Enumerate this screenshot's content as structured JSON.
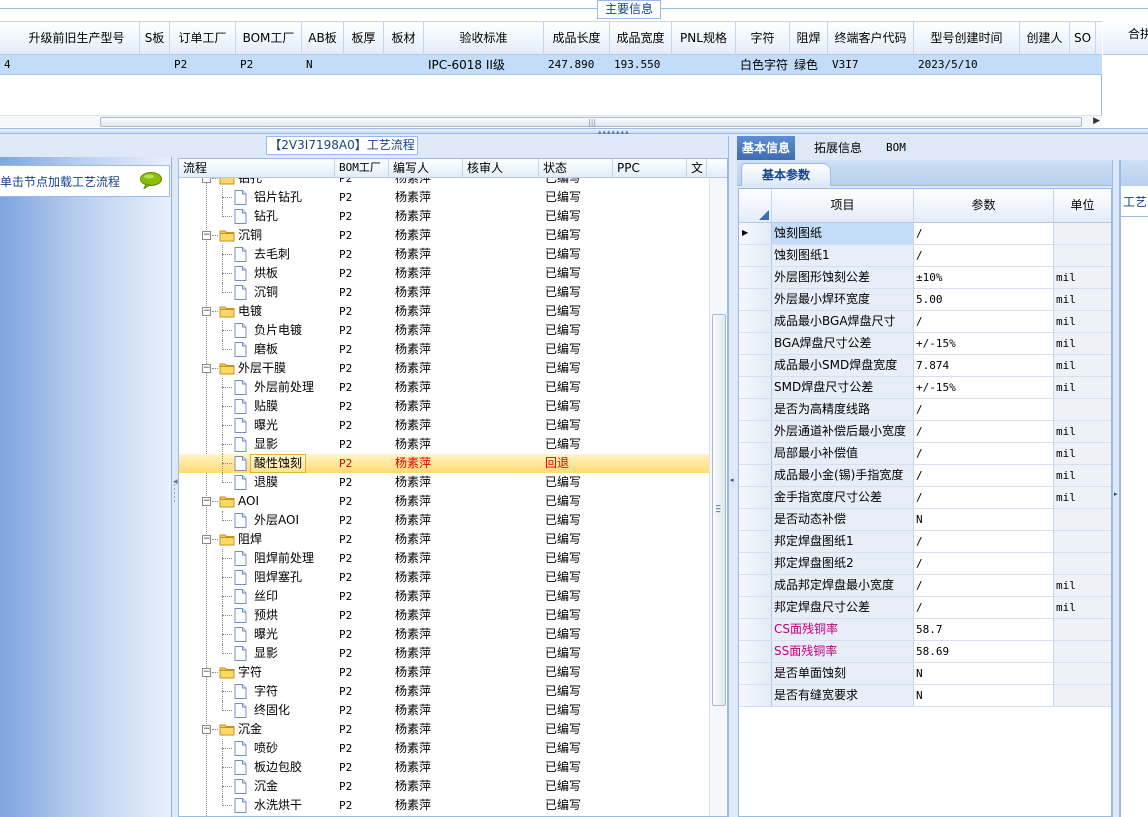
{
  "top": {
    "title": "主要信息",
    "columns": [
      "升级前旧生产型号",
      "S板",
      "订单工厂",
      "BOM工厂",
      "AB板",
      "板厚",
      "板材",
      "验收标准",
      "成品长度",
      "成品宽度",
      "PNL规格",
      "字符",
      "阻焊",
      "终端客户代码",
      "型号创建时间",
      "创建人",
      "SO"
    ],
    "row_prefix": "4",
    "row": [
      "",
      "",
      "P2",
      "P2",
      "N",
      "",
      "",
      "IPC-6018 II级",
      "247.890",
      "193.550",
      "",
      "白色字符",
      "绿色",
      "V3I7",
      "2023/5/10",
      "",
      ""
    ],
    "right_header": "合拼"
  },
  "left": {
    "hint": "单击节点加载工艺流程"
  },
  "process": {
    "title": "【2V3I7198A0】工艺流程",
    "columns": [
      "流程",
      "BOM工厂",
      "编写人",
      "核审人",
      "状态",
      "PPC",
      "文"
    ],
    "rows": [
      {
        "name": "铝孔",
        "type": "folder",
        "bom": "P2",
        "author": "杨素萍",
        "status": "已编写"
      },
      {
        "name": "铝片钻孔",
        "type": "leaf",
        "bom": "P2",
        "author": "杨素萍",
        "status": "已编写"
      },
      {
        "name": "钻孔",
        "type": "leaf",
        "bom": "P2",
        "author": "杨素萍",
        "status": "已编写"
      },
      {
        "name": "沉铜",
        "type": "folder",
        "bom": "P2",
        "author": "杨素萍",
        "status": "已编写"
      },
      {
        "name": "去毛刺",
        "type": "leaf",
        "bom": "P2",
        "author": "杨素萍",
        "status": "已编写"
      },
      {
        "name": "烘板",
        "type": "leaf",
        "bom": "P2",
        "author": "杨素萍",
        "status": "已编写"
      },
      {
        "name": "沉铜",
        "type": "leaf",
        "bom": "P2",
        "author": "杨素萍",
        "status": "已编写"
      },
      {
        "name": "电镀",
        "type": "folder",
        "bom": "P2",
        "author": "杨素萍",
        "status": "已编写"
      },
      {
        "name": "负片电镀",
        "type": "leaf",
        "bom": "P2",
        "author": "杨素萍",
        "status": "已编写"
      },
      {
        "name": "磨板",
        "type": "leaf",
        "bom": "P2",
        "author": "杨素萍",
        "status": "已编写"
      },
      {
        "name": "外层干膜",
        "type": "folder",
        "bom": "P2",
        "author": "杨素萍",
        "status": "已编写"
      },
      {
        "name": "外层前处理",
        "type": "leaf",
        "bom": "P2",
        "author": "杨素萍",
        "status": "已编写"
      },
      {
        "name": "贴膜",
        "type": "leaf",
        "bom": "P2",
        "author": "杨素萍",
        "status": "已编写"
      },
      {
        "name": "曝光",
        "type": "leaf",
        "bom": "P2",
        "author": "杨素萍",
        "status": "已编写"
      },
      {
        "name": "显影",
        "type": "leaf",
        "bom": "P2",
        "author": "杨素萍",
        "status": "已编写"
      },
      {
        "name": "酸性蚀刻",
        "type": "leaf",
        "bom": "P2",
        "author": "杨素萍",
        "status": "回退",
        "selected": true
      },
      {
        "name": "退膜",
        "type": "leaf",
        "bom": "P2",
        "author": "杨素萍",
        "status": "已编写"
      },
      {
        "name": "AOI",
        "type": "folder",
        "bom": "P2",
        "author": "杨素萍",
        "status": "已编写"
      },
      {
        "name": "外层AOI",
        "type": "leaf",
        "bom": "P2",
        "author": "杨素萍",
        "status": "已编写"
      },
      {
        "name": "阻焊",
        "type": "folder",
        "bom": "P2",
        "author": "杨素萍",
        "status": "已编写"
      },
      {
        "name": "阻焊前处理",
        "type": "leaf",
        "bom": "P2",
        "author": "杨素萍",
        "status": "已编写"
      },
      {
        "name": "阻焊塞孔",
        "type": "leaf",
        "bom": "P2",
        "author": "杨素萍",
        "status": "已编写"
      },
      {
        "name": "丝印",
        "type": "leaf",
        "bom": "P2",
        "author": "杨素萍",
        "status": "已编写"
      },
      {
        "name": "预烘",
        "type": "leaf",
        "bom": "P2",
        "author": "杨素萍",
        "status": "已编写"
      },
      {
        "name": "曝光",
        "type": "leaf",
        "bom": "P2",
        "author": "杨素萍",
        "status": "已编写"
      },
      {
        "name": "显影",
        "type": "leaf",
        "bom": "P2",
        "author": "杨素萍",
        "status": "已编写"
      },
      {
        "name": "字符",
        "type": "folder",
        "bom": "P2",
        "author": "杨素萍",
        "status": "已编写"
      },
      {
        "name": "字符",
        "type": "leaf",
        "bom": "P2",
        "author": "杨素萍",
        "status": "已编写"
      },
      {
        "name": "终固化",
        "type": "leaf",
        "bom": "P2",
        "author": "杨素萍",
        "status": "已编写"
      },
      {
        "name": "沉金",
        "type": "folder",
        "bom": "P2",
        "author": "杨素萍",
        "status": "已编写"
      },
      {
        "name": "喷砂",
        "type": "leaf",
        "bom": "P2",
        "author": "杨素萍",
        "status": "已编写"
      },
      {
        "name": "板边包胶",
        "type": "leaf",
        "bom": "P2",
        "author": "杨素萍",
        "status": "已编写"
      },
      {
        "name": "沉金",
        "type": "leaf",
        "bom": "P2",
        "author": "杨素萍",
        "status": "已编写"
      },
      {
        "name": "水洗烘干",
        "type": "leaf",
        "bom": "P2",
        "author": "杨素萍",
        "status": "已编写"
      }
    ]
  },
  "right": {
    "tabs": [
      "基本信息",
      "拓展信息",
      "BOM"
    ],
    "subtab": "基本参数",
    "columns": [
      "项目",
      "参数",
      "单位"
    ],
    "rows": [
      {
        "item": "蚀刻图纸",
        "value": "/",
        "unit": ""
      },
      {
        "item": "蚀刻图纸1",
        "value": "/",
        "unit": ""
      },
      {
        "item": "外层图形蚀刻公差",
        "value": "±10%",
        "unit": "mil"
      },
      {
        "item": "外层最小焊环宽度",
        "value": "5.00",
        "unit": "mil"
      },
      {
        "item": "成品最小BGA焊盘尺寸",
        "value": "/",
        "unit": "mil"
      },
      {
        "item": "BGA焊盘尺寸公差",
        "value": "+/-15%",
        "unit": "mil"
      },
      {
        "item": "成品最小SMD焊盘宽度",
        "value": "7.874",
        "unit": "mil"
      },
      {
        "item": "SMD焊盘尺寸公差",
        "value": "+/-15%",
        "unit": "mil"
      },
      {
        "item": "是否为高精度线路",
        "value": "/",
        "unit": ""
      },
      {
        "item": "外层通道补偿后最小宽度",
        "value": "/",
        "unit": "mil"
      },
      {
        "item": "局部最小补偿值",
        "value": "/",
        "unit": "mil"
      },
      {
        "item": "成品最小金(锡)手指宽度",
        "value": "/",
        "unit": "mil"
      },
      {
        "item": "金手指宽度尺寸公差",
        "value": "/",
        "unit": "mil"
      },
      {
        "item": "是否动态补偿",
        "value": "N",
        "unit": ""
      },
      {
        "item": "邦定焊盘图纸1",
        "value": "/",
        "unit": ""
      },
      {
        "item": "邦定焊盘图纸2",
        "value": "/",
        "unit": ""
      },
      {
        "item": "成品邦定焊盘最小宽度",
        "value": "/",
        "unit": "mil"
      },
      {
        "item": "邦定焊盘尺寸公差",
        "value": "/",
        "unit": "mil"
      },
      {
        "item": "CS面残铜率",
        "value": "58.7",
        "unit": "",
        "highlight": true
      },
      {
        "item": "SS面残铜率",
        "value": "58.69",
        "unit": "",
        "highlight": true
      },
      {
        "item": "是否单面蚀刻",
        "value": "N",
        "unit": ""
      },
      {
        "item": "是否有缝宽要求",
        "value": "N",
        "unit": ""
      }
    ],
    "far_right_label": "工艺",
    "highlight_color": "#c0007a"
  }
}
